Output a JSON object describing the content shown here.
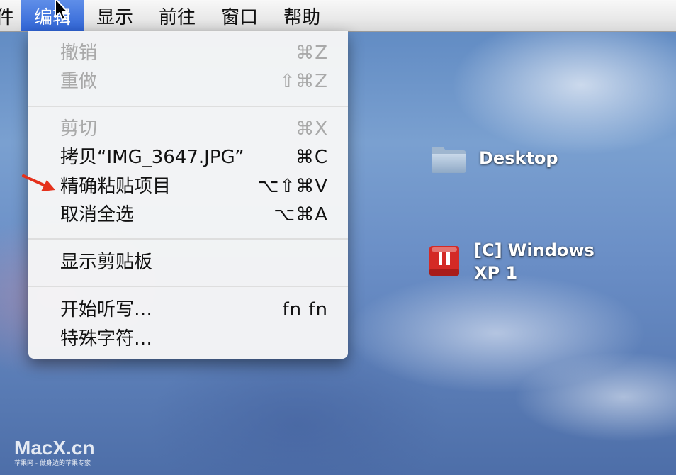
{
  "menubar": {
    "items": [
      "件",
      "编辑",
      "显示",
      "前往",
      "窗口",
      "帮助"
    ],
    "active_index": 1
  },
  "edit_menu": {
    "items": [
      {
        "label": "撤销",
        "shortcut": "⌘Z",
        "enabled": false
      },
      {
        "label": "重做",
        "shortcut": "⇧⌘Z",
        "enabled": false
      },
      {
        "label": "剪切",
        "shortcut": "⌘X",
        "enabled": false
      },
      {
        "label": "拷贝“IMG_3647.JPG”",
        "shortcut": "⌘C",
        "enabled": true
      },
      {
        "label": "精确粘贴项目",
        "shortcut": "⌥⇧⌘V",
        "enabled": true
      },
      {
        "label": "取消全选",
        "shortcut": "⌥⌘A",
        "enabled": true
      },
      {
        "label": "显示剪贴板",
        "shortcut": "",
        "enabled": true
      },
      {
        "label": "开始听写…",
        "shortcut": "fn fn",
        "enabled": true
      },
      {
        "label": "特殊字符…",
        "shortcut": "",
        "enabled": true
      }
    ]
  },
  "desktop": {
    "icons": [
      {
        "label": "Desktop",
        "icon": "folder-icon"
      },
      {
        "label_line1": "[C] Windows",
        "label_line2": "XP 1",
        "icon": "drive-icon"
      }
    ]
  },
  "watermark": {
    "main": "MacX.cn",
    "sub": "苹果网 - 做身边的苹果专家"
  },
  "colors": {
    "menu_highlight": "#3a6ee0",
    "annotation_arrow": "#e5311c",
    "drive_red": "#d42a26"
  }
}
